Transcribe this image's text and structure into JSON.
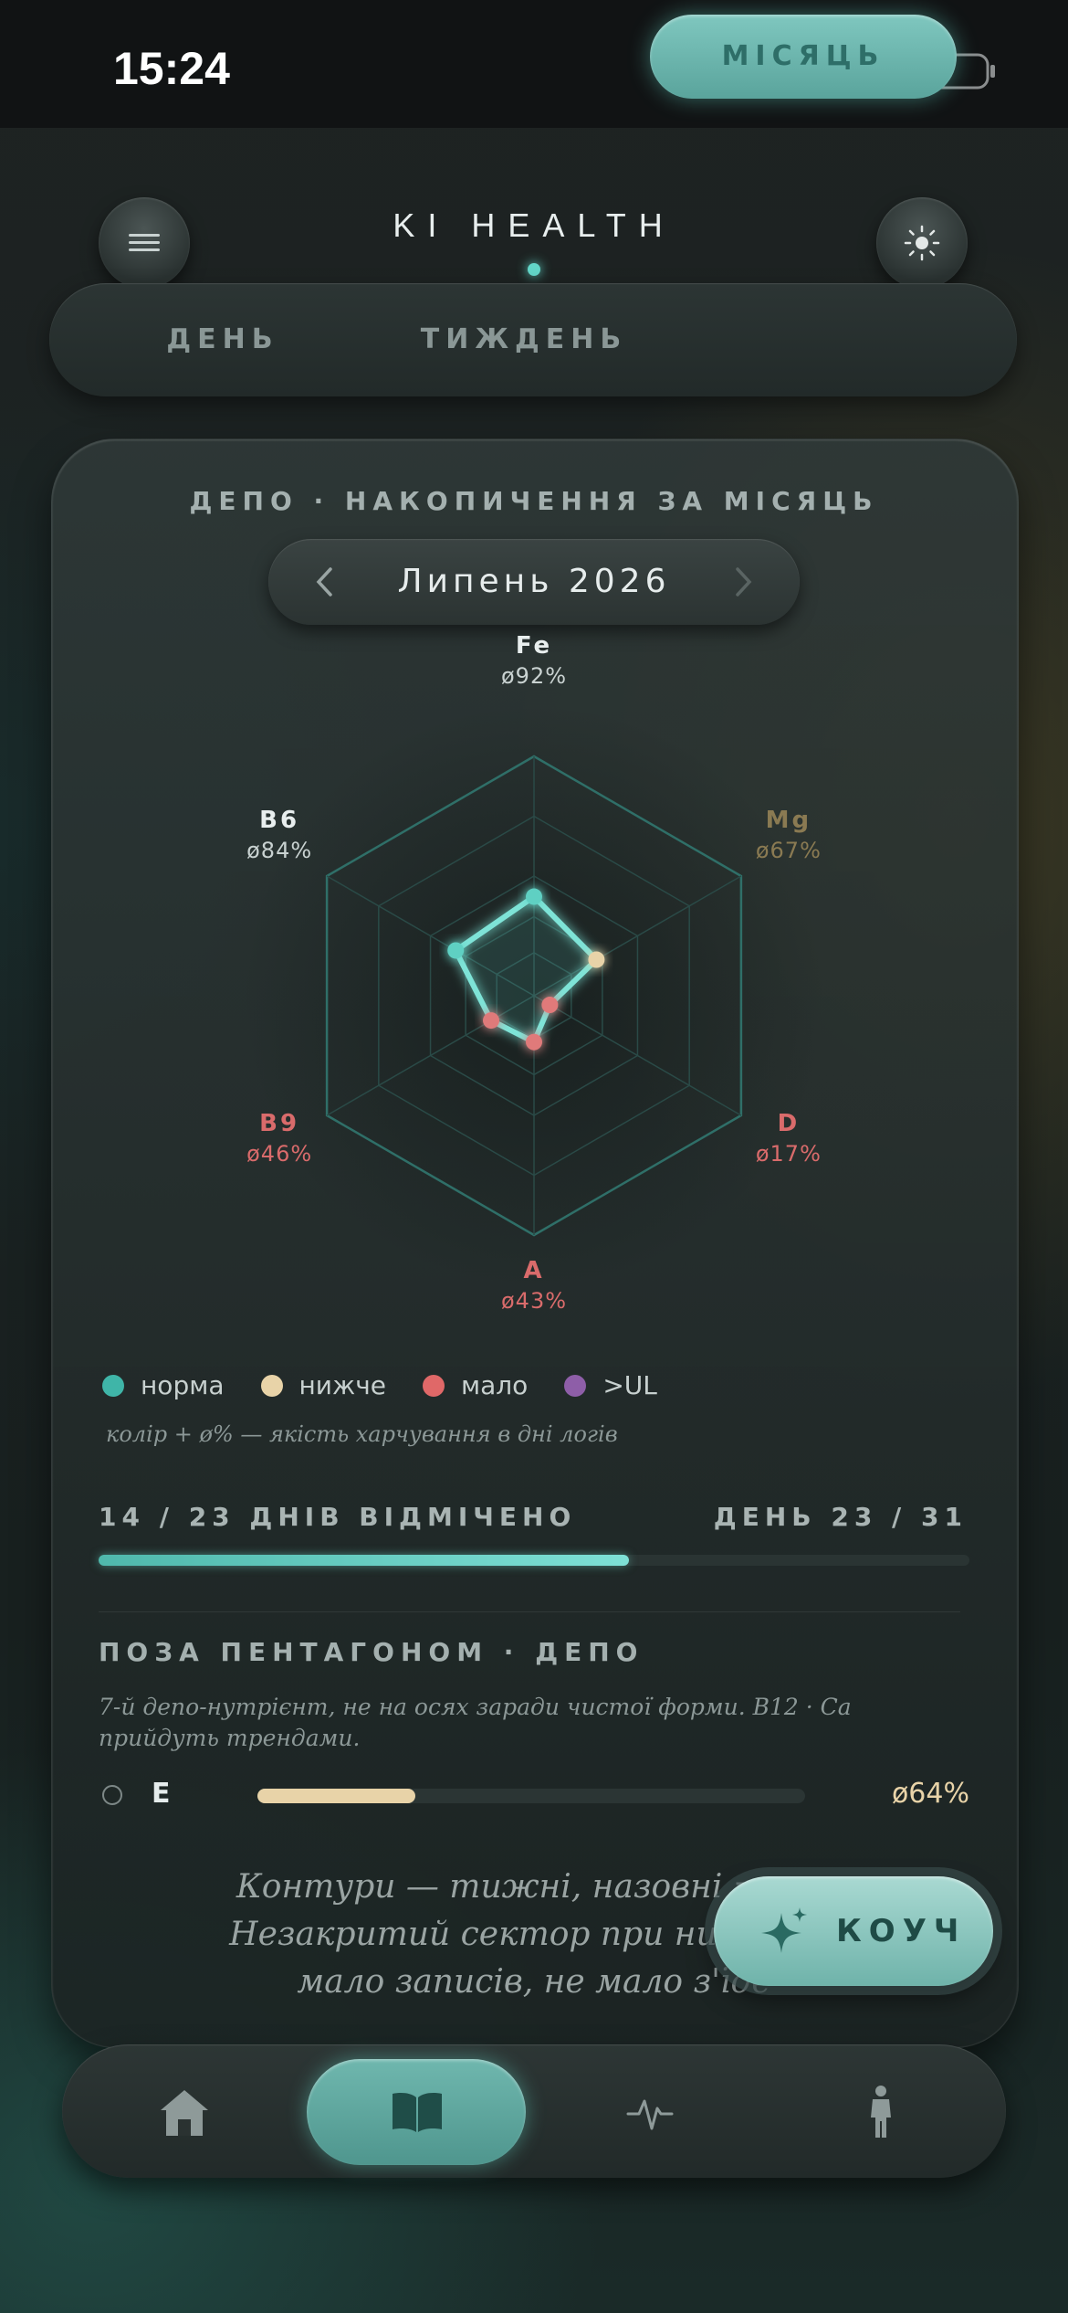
{
  "status_bar": {
    "time": "15:24"
  },
  "header": {
    "title": "KI HEALTH",
    "menu_icon": "hamburger-icon",
    "theme_icon": "sun-icon"
  },
  "period_tabs": {
    "items": [
      "ДЕНЬ",
      "ТИЖДЕНЬ",
      "МІСЯЦЬ"
    ],
    "active": "МІСЯЦЬ"
  },
  "depot": {
    "title": "ДЕПО · НАКОПИЧЕННЯ ЗА МІСЯЦЬ",
    "month": "Липень 2026",
    "radar": {
      "axes": [
        {
          "name": "Fe",
          "value_label": "ø92%",
          "value": 92,
          "status": "норма"
        },
        {
          "name": "Mg",
          "value_label": "ø67%",
          "value": 67,
          "status": "нижче"
        },
        {
          "name": "D",
          "value_label": "ø17%",
          "value": 17,
          "status": "мало"
        },
        {
          "name": "A",
          "value_label": "ø43%",
          "value": 43,
          "status": "мало"
        },
        {
          "name": "B9",
          "value_label": "ø46%",
          "value": 46,
          "status": "мало"
        },
        {
          "name": "B6",
          "value_label": "ø84%",
          "value": 84,
          "status": "норма"
        }
      ]
    },
    "legend": [
      {
        "label": "норма",
        "color": "#3fb5a8"
      },
      {
        "label": "нижче",
        "color": "#e8d3a8"
      },
      {
        "label": "мало",
        "color": "#e06868"
      },
      {
        "label": ">UL",
        "color": "#8e5ea8"
      }
    ],
    "legend_note": "колір + ø% — якість харчування в дні логів",
    "progress": {
      "left": "14 / 23 ДНІВ ВІДМІЧЕНО",
      "right": "ДЕНЬ 23 / 31",
      "fraction": 0.609
    },
    "outside": {
      "title": "ПОЗА ПЕНТАГОНОМ · ДЕПО",
      "note": "7-й депо-нутрієнт, не на осях заради чистої форми. B12 · Ca прийдуть трендами.",
      "items": [
        {
          "name": "E",
          "value_label": "ø64%",
          "value": 64
        }
      ]
    },
    "quote_lines": [
      "Контури — тижні, назовні = нак",
      "Незакритий сектор при низькому",
      "мало записів, не мало з'їде"
    ]
  },
  "coach_button": {
    "label": "КОУЧ",
    "icon": "sparkles-icon"
  },
  "tab_bar": {
    "items": [
      "home-icon",
      "book-icon",
      "pulse-icon",
      "person-icon"
    ],
    "active": "book-icon"
  },
  "colors": {
    "accent": "#63d6c9",
    "normal": "#3fb5a8",
    "low": "#e8d3a8",
    "poor": "#e06868"
  }
}
